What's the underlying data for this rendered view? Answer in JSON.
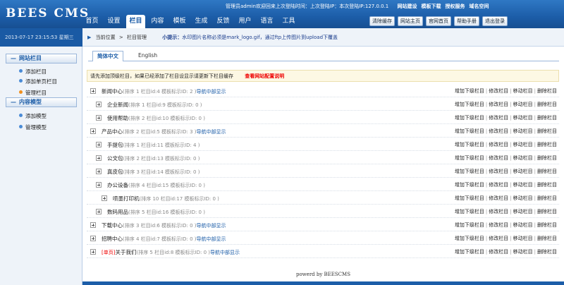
{
  "header": {
    "logo": "BEES CMS",
    "info": "管理员admin欢迎回来上次登陆时间：上次登陆IP：本次登陆IP:127.0.0.1",
    "links": [
      "网站建设",
      "模板下载",
      "授权服务",
      "域名空间"
    ],
    "nav": [
      "首页",
      "设置",
      "栏目",
      "内容",
      "模板",
      "生成",
      "反馈",
      "用户",
      "语言",
      "工具"
    ],
    "nav_active": 2,
    "toolbar": [
      "清除缓存",
      "网站主页",
      "官网首页",
      "帮助手册",
      "退出登录"
    ]
  },
  "datetime": "2013-07-17 23:15:53 星期三",
  "breadcrumb": {
    "label": "当前位置",
    "path": "栏目管理",
    "tip_prefix": "小提示：",
    "tip_text": "水印图片名称必须是mark_logo.gif，通过ftp上传图片到upload下覆盖"
  },
  "sidebar": {
    "groups": [
      {
        "title": "网站栏目",
        "items": [
          "添加栏目",
          "添加单页栏目",
          "管理栏目"
        ]
      },
      {
        "title": "内容模型",
        "items": [
          "添加模型",
          "管理模型"
        ]
      }
    ]
  },
  "tabs": [
    "简体中文",
    "English"
  ],
  "notice": {
    "text": "请先添加顶级栏目，如果已经添加了栏目设显示请更新下栏目缓存",
    "link": "查看网站配置说明"
  },
  "categories": [
    {
      "prefix": "",
      "name": "新闻中心",
      "order": "1",
      "id": "4",
      "model_id": "2",
      "nav": "导航中部显示",
      "indent": 0
    },
    {
      "prefix": "",
      "name": "企业新闻",
      "order": "1",
      "id": "9",
      "model_id": "0",
      "nav": "",
      "indent": 1
    },
    {
      "prefix": "",
      "name": "使用帮助",
      "order": "2",
      "id": "10",
      "model_id": "0",
      "nav": "",
      "indent": 1
    },
    {
      "prefix": "",
      "name": "产品中心",
      "order": "2",
      "id": "5",
      "model_id": "3",
      "nav": "导航中部显示",
      "indent": 0
    },
    {
      "prefix": "",
      "name": "手提包",
      "order": "1",
      "id": "11",
      "model_id": "4",
      "nav": "",
      "indent": 1
    },
    {
      "prefix": "",
      "name": "公文包",
      "order": "2",
      "id": "13",
      "model_id": "0",
      "nav": "",
      "indent": 1
    },
    {
      "prefix": "",
      "name": "真皮包",
      "order": "3",
      "id": "14",
      "model_id": "0",
      "nav": "",
      "indent": 1
    },
    {
      "prefix": "",
      "name": "办公设备",
      "order": "4",
      "id": "15",
      "model_id": "0",
      "nav": "",
      "indent": 1
    },
    {
      "prefix": "",
      "name": "喷墨打印机",
      "order": "10",
      "id": "17",
      "model_id": "0",
      "nav": "",
      "indent": 2
    },
    {
      "prefix": "",
      "name": "数码用品",
      "order": "5",
      "id": "16",
      "model_id": "0",
      "nav": "",
      "indent": 1
    },
    {
      "prefix": "",
      "name": "下载中心",
      "order": "3",
      "id": "6",
      "model_id": "0",
      "nav": "导航中部显示",
      "indent": 0
    },
    {
      "prefix": "",
      "name": "招聘中心",
      "order": "4",
      "id": "7",
      "model_id": "0",
      "nav": "导航中部显示",
      "indent": 0
    },
    {
      "prefix": "[单页]",
      "name": "关于我们",
      "order": "5",
      "id": "8",
      "model_id": "0",
      "nav": "导航中部显示",
      "indent": 0
    }
  ],
  "row_labels": {
    "order": "排序",
    "id": "栏目id:",
    "model": "模板标示ID:"
  },
  "actions": [
    "增加下级栏目",
    "修改栏目",
    "移动栏目",
    "删除栏目"
  ],
  "footer": "powerd by BEESCMS"
}
